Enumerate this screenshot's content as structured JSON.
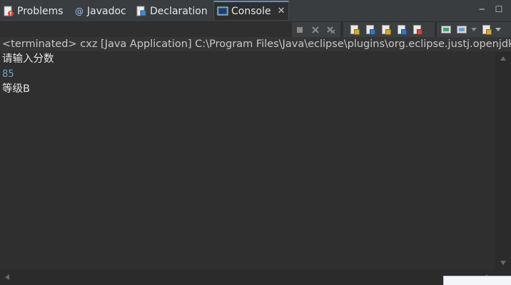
{
  "tabs": [
    {
      "label": "Problems",
      "icon": "problems-icon"
    },
    {
      "label": "Javadoc",
      "icon": "javadoc-icon"
    },
    {
      "label": "Declaration",
      "icon": "declaration-icon"
    },
    {
      "label": "Console",
      "icon": "console-icon",
      "active": true
    }
  ],
  "tab_close_glyph": "✕",
  "window_controls": {
    "minimize": "─",
    "maximize": "☐"
  },
  "status_line": "<terminated> cxz [Java Application] C:\\Program Files\\Java\\eclipse\\plugins\\org.eclipse.justj.openjdk",
  "console_lines": [
    {
      "text": "请输入分数",
      "kind": "output"
    },
    {
      "text": "85",
      "kind": "input"
    },
    {
      "text": "等级B",
      "kind": "output"
    }
  ],
  "colors": {
    "background": "#2f2f2f",
    "tab_bar": "#393d40",
    "active_tab_accent": "#5f90c6",
    "output_text": "#e6e6e6",
    "input_text": "#6a9fc0"
  }
}
